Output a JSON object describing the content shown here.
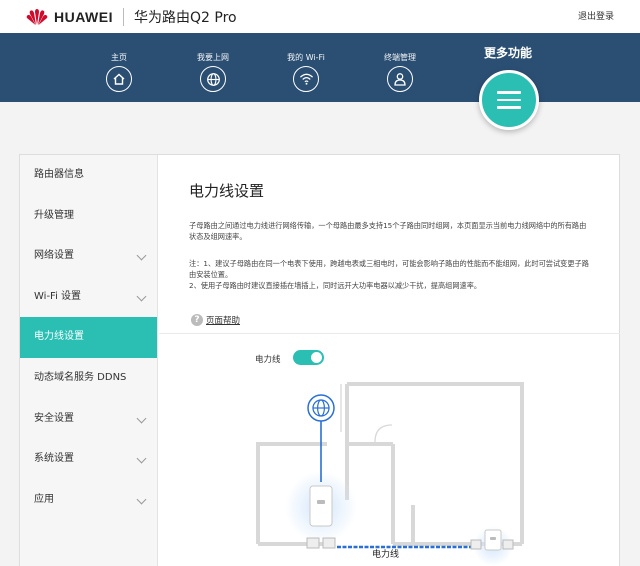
{
  "header": {
    "brand": "HUAWEI",
    "product": "华为路由Q2 Pro",
    "logout_label": "退出登录"
  },
  "nav": {
    "items": [
      {
        "label": "主页",
        "icon": "home-icon"
      },
      {
        "label": "我要上网",
        "icon": "globe-icon"
      },
      {
        "label": "我的 Wi-Fi",
        "icon": "wifi-icon"
      },
      {
        "label": "终端管理",
        "icon": "user-icon"
      }
    ],
    "more_label": "更多功能",
    "more_icon": "menu-icon"
  },
  "sidebar": {
    "items": [
      {
        "label": "路由器信息",
        "expandable": false
      },
      {
        "label": "升级管理",
        "expandable": false
      },
      {
        "label": "网络设置",
        "expandable": true
      },
      {
        "label": "Wi-Fi 设置",
        "expandable": true
      },
      {
        "label": "电力线设置",
        "expandable": false,
        "active": true
      },
      {
        "label": "动态域名服务 DDNS",
        "expandable": false
      },
      {
        "label": "安全设置",
        "expandable": true
      },
      {
        "label": "系统设置",
        "expandable": true
      },
      {
        "label": "应用",
        "expandable": true
      }
    ]
  },
  "content": {
    "title": "电力线设置",
    "description": "子母路由之间通过电力线进行网络传输，一个母路由最多支持15个子路由同时组网，本页面显示当前电力线网络中的所有路由状态及组网速率。",
    "note_line1": "注：1、建议子母路由在同一个电表下使用，跨越电表或三相电时，可能会影响子路由的性能而不能组网，此时可尝试变更子路由安装位置。",
    "note_line2": "2、使用子母路由时建议直接插在墙插上，同时远开大功率电器以减少干扰，提高组网速率。",
    "help_label": "页面帮助",
    "toggle_label": "电力线",
    "toggle_on": true,
    "diagram_caption": "电力线"
  },
  "colors": {
    "accent": "#2bbfb3",
    "nav_bg": "#2b4f73",
    "brand_red": "#cf0a2c",
    "powerline_blue": "#2a6fd6"
  }
}
